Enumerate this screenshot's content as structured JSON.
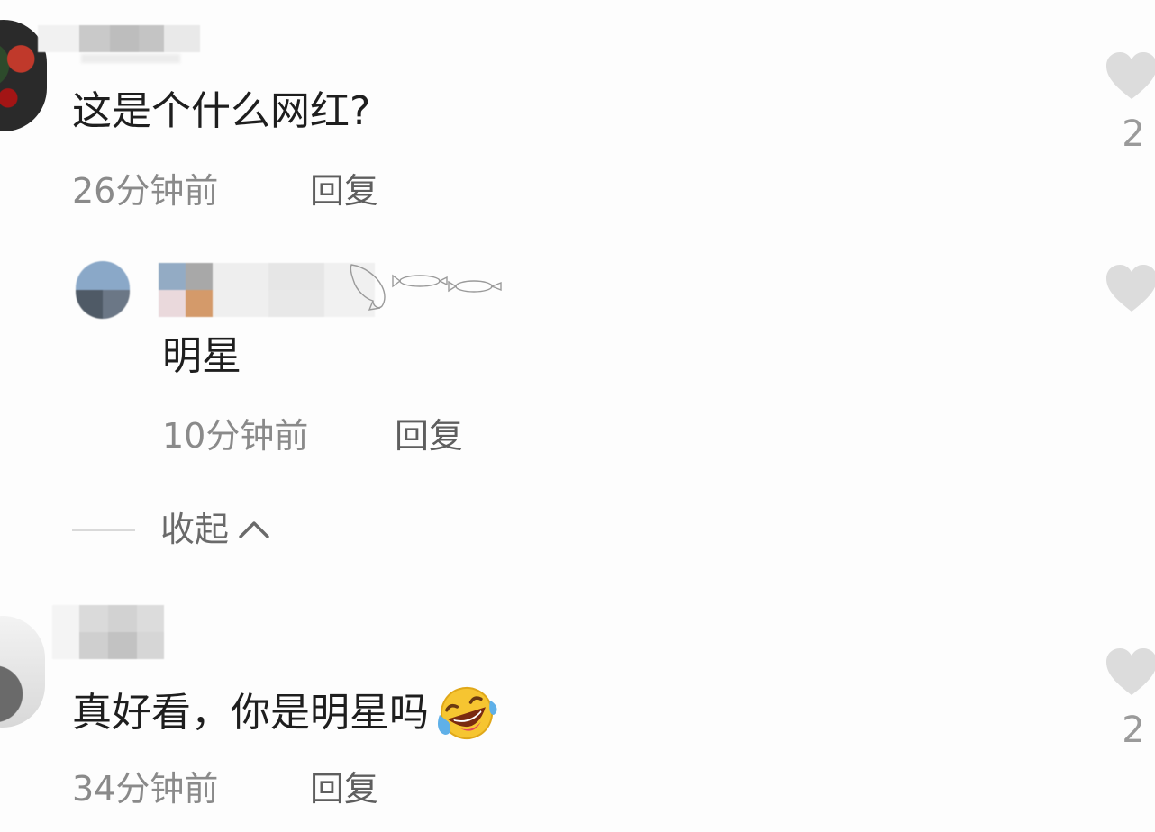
{
  "comments": [
    {
      "text": "这是个什么网红?",
      "time": "26分钟前",
      "reply_label": "回复",
      "likes": "2",
      "replies": [
        {
          "text": "明星",
          "time": "10分钟前",
          "reply_label": "回复"
        }
      ],
      "collapse_label": "收起"
    },
    {
      "text": "真好看，你是明星吗",
      "emoji": "🤣",
      "time": "34分钟前",
      "reply_label": "回复",
      "likes": "2"
    }
  ],
  "icons": {
    "like": "heart-icon",
    "collapse": "chevron-up-icon",
    "emoji": "rolling-on-floor-laughing-emoji"
  },
  "colors": {
    "background": "#fdfdfd",
    "text": "#1e1e1e",
    "meta": "#8a8a8a",
    "heart": "#dcdcdc"
  }
}
